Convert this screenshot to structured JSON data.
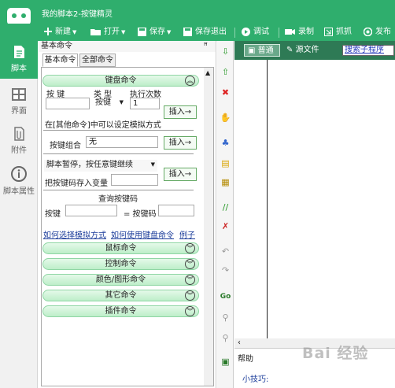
{
  "app": {
    "title": "我的脚本2-按键精灵"
  },
  "toolbar": {
    "new": "新建",
    "open": "打开",
    "save": "保存",
    "save_exit": "保存退出",
    "debug": "调试",
    "record": "录制",
    "capture": "抓抓",
    "publish": "发布"
  },
  "nav": {
    "script": "脚本",
    "interface": "界面",
    "attachment": "附件",
    "properties": "脚本属性"
  },
  "panel": {
    "title": "基本命令",
    "pin": "ꟸ"
  },
  "tabs": [
    "基本命令",
    "全部命令"
  ],
  "keyboard": {
    "section": "键盘命令",
    "col_key": "按 键",
    "col_type": "类 型",
    "col_exec": "执行次数",
    "type_value": "按键",
    "count_value": "1",
    "insert": "插入→",
    "hint": "在[其他命令]中可以设定模拟方式",
    "combo_label": "按键组合",
    "combo_value": "无",
    "pause_value": "脚本暂停，按任意键继续",
    "store_label": "把按键码存入变量",
    "query_title": "查询按键码",
    "query_key": "按键",
    "query_code": "= 按键码"
  },
  "links": [
    "如何选择模拟方式",
    "如何使用键盘命令",
    "例子"
  ],
  "sections": [
    "鼠标命令",
    "控制命令",
    "颜色/图形命令",
    "其它命令",
    "插件命令"
  ],
  "editor": {
    "tab_normal": "普通",
    "tab_source": "源文件",
    "search": "搜索子程序"
  },
  "help": {
    "title": "帮助",
    "tip": "小技巧:"
  },
  "watermark": "Bai 经验",
  "colors": {
    "brand_green": "#2fae6d",
    "editor_tabbar": "#2e7a55",
    "link": "#1b3c9a"
  }
}
